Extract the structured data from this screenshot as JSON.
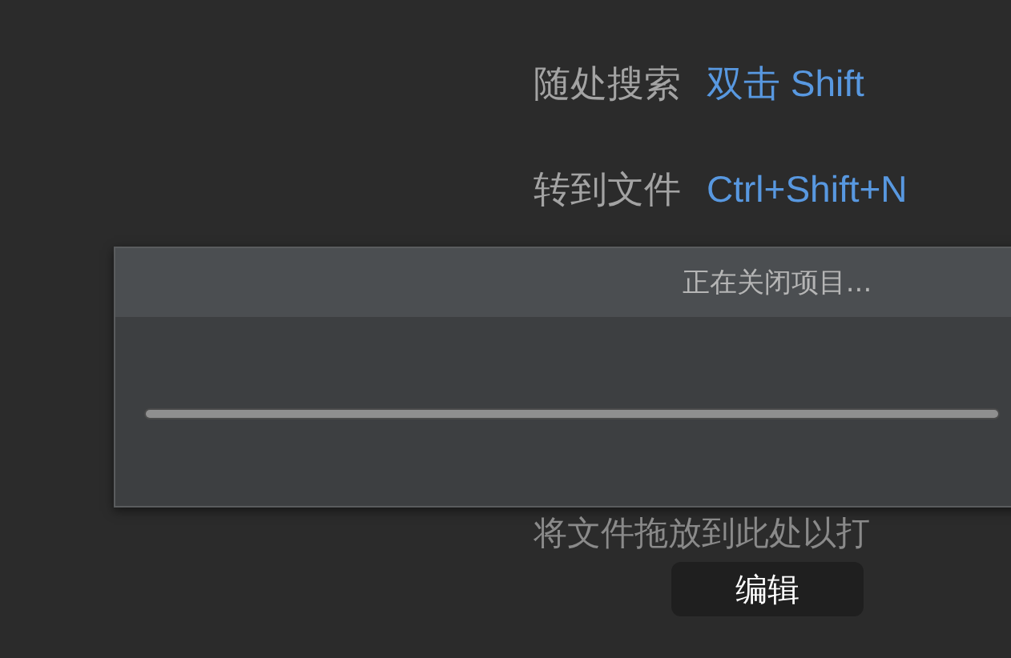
{
  "shortcuts": [
    {
      "label": "随处搜索",
      "keys": "双击 Shift"
    },
    {
      "label": "转到文件",
      "keys": "Ctrl+Shift+N"
    }
  ],
  "progress_dialog": {
    "title": "正在关闭项目...",
    "level": 1
  },
  "drop_hint": "将文件拖放到此处以打",
  "tooltip": "编辑"
}
